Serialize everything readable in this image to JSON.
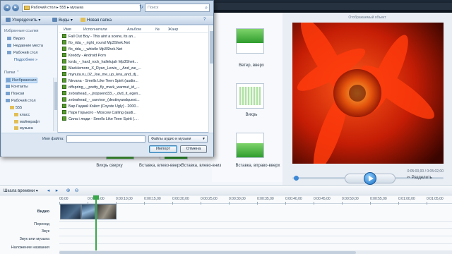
{
  "dialog": {
    "address": [
      "Рабочий стол",
      "555",
      "музыка"
    ],
    "search_placeholder": "Поиск",
    "toolbar": {
      "organize": "Упорядочить",
      "views": "Виды",
      "new_folder": "Новая папка"
    },
    "nav": {
      "favorites_header": "Избранные ссылки",
      "favorites": [
        "Видео",
        "Недавние места",
        "Рабочий стол"
      ],
      "more": "Подробнее",
      "folders_header": "Папки",
      "tree": [
        "Изображения",
        "Контакты",
        "Поиски",
        "Рабочий стол",
        "555",
        "класс",
        "майнкрафт",
        "музыка"
      ]
    },
    "columns": [
      "Имя",
      "Исполнители",
      "Альбом",
      "№",
      "Жанр"
    ],
    "files": [
      "Fall Out Boy - This aint a scene, its an...",
      "flo_rida_-_right_round Mp3Shek.Net",
      "flo_rida_-_whistle Mp3Shek.Net",
      "Kreddy - Android Porn",
      "lords_-_hard_rock_hallelujah Mp3Shek...",
      "Macklemore_X_Ryan_Lewis_-_And_we_...",
      "mynuta.ru_02_Joe_me_up_lera_and_dj...",
      "Nirvana - Smells Like Teen Spirit (audio...",
      "offspring_-_pretty_fly_mark_warmut_id_...",
      "zebrahead_-_jnopsend33_-_dvd_it_egen...",
      "zebrahead_-_survivor_(destinyandquest...",
      "Бар Гадкий Койот (Coyote Ugly) - 2000...",
      "Парк Горького - Moscow Calling (audi...",
      "Сила і люди - Smells Like Teen Spirit (...."
    ],
    "filename_label": "Имя файла:",
    "filename_value": "",
    "filetype": "Файлы аудио и музыки",
    "import_label": "Импорт",
    "cancel_label": "Отмена"
  },
  "transitions": {
    "row_labels": [
      "Ветер, вверх",
      "Вихрь"
    ],
    "bottom_labels": [
      "Вихрь сверху",
      "Вставка, влево-вверх",
      "Вставка, влево-вниз",
      "Вставка, вправо-вверх"
    ]
  },
  "preview": {
    "title": "Отображаемый объект",
    "time": "0:05:00,00 / 0:05:02,00",
    "split_label": "Разделить"
  },
  "timeline": {
    "label": "Шкала времени",
    "ticks": [
      "00,00",
      "0:00:05,00",
      "0:00:10,00",
      "0:00:15,00",
      "0:00:20,00",
      "0:00:25,00",
      "0:00:30,00",
      "0:00:35,00",
      "0:00:40,00",
      "0:00:45,00",
      "0:00:50,00",
      "0:00:55,00",
      "0:01:00,00",
      "0:01:05,00"
    ],
    "tracks": [
      "Видео",
      "Переход",
      "Звук",
      "Звук или музыка",
      "Наложение названия"
    ]
  },
  "colors": {
    "accent": "#3c88d6",
    "playhead": "#39a84a",
    "dialog_frame": "#c5d6e8"
  }
}
